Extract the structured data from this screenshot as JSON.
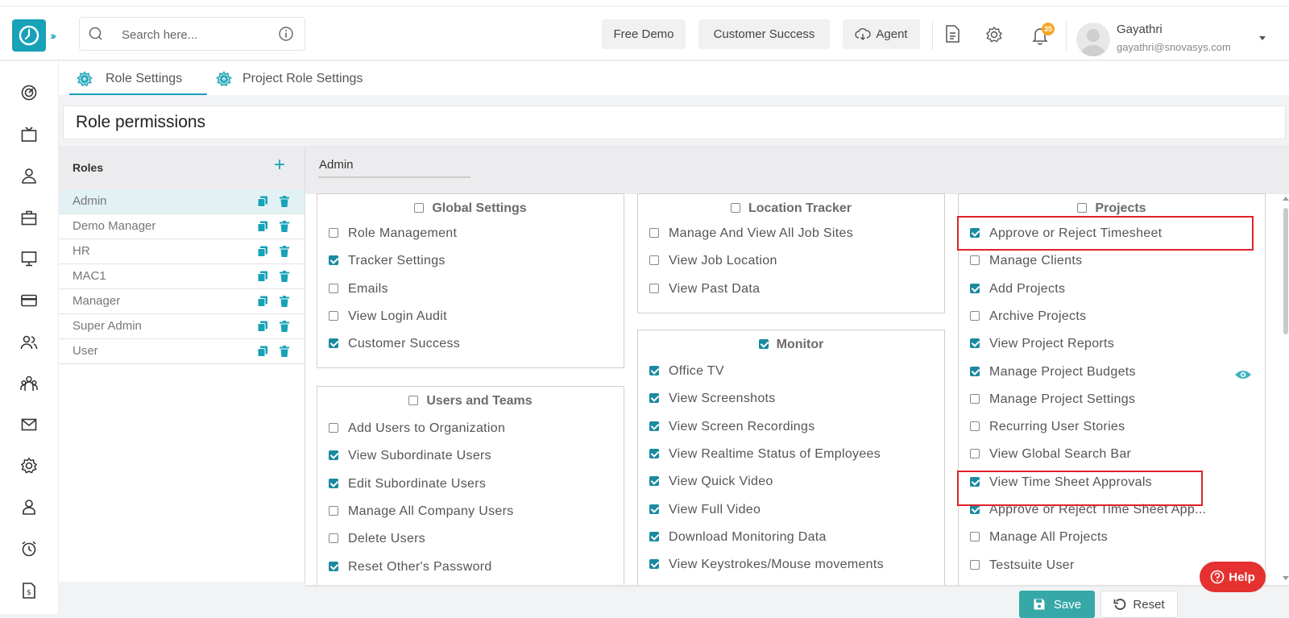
{
  "header": {
    "search_placeholder": "Search here...",
    "buttons": {
      "free_demo": "Free Demo",
      "customer_success": "Customer Success",
      "agent": "Agent"
    },
    "notification_count": "35",
    "user": {
      "name": "Gayathri",
      "email": "gayathri@snovasys.com"
    }
  },
  "tabs": [
    {
      "label": "Role Settings",
      "active": true
    },
    {
      "label": "Project Role Settings",
      "active": false
    }
  ],
  "page_title": "Role permissions",
  "roles": {
    "title": "Roles",
    "items": [
      "Admin",
      "Demo Manager",
      "HR",
      "MAC1",
      "Manager",
      "Super Admin",
      "User"
    ],
    "selected": "Admin"
  },
  "selected_role": "Admin",
  "sections": {
    "global_settings": {
      "title": "Global Settings",
      "checked": false,
      "items": [
        {
          "label": "Role Management",
          "checked": false
        },
        {
          "label": "Tracker Settings",
          "checked": true
        },
        {
          "label": "Emails",
          "checked": false
        },
        {
          "label": "View Login Audit",
          "checked": false
        },
        {
          "label": "Customer Success",
          "checked": true
        }
      ]
    },
    "users_and_teams": {
      "title": "Users and Teams",
      "checked": false,
      "items": [
        {
          "label": "Add Users to Organization",
          "checked": false
        },
        {
          "label": "View Subordinate Users",
          "checked": true
        },
        {
          "label": "Edit Subordinate Users",
          "checked": true
        },
        {
          "label": "Manage All Company Users",
          "checked": false
        },
        {
          "label": "Delete Users",
          "checked": false
        },
        {
          "label": "Reset Other's Password",
          "checked": true
        }
      ]
    },
    "location_tracker": {
      "title": "Location Tracker",
      "checked": false,
      "items": [
        {
          "label": "Manage And View All Job Sites",
          "checked": false
        },
        {
          "label": "View Job Location",
          "checked": false
        },
        {
          "label": "View Past Data",
          "checked": false
        }
      ]
    },
    "monitor": {
      "title": "Monitor",
      "checked": true,
      "items": [
        {
          "label": "Office TV",
          "checked": true
        },
        {
          "label": "View Screenshots",
          "checked": true
        },
        {
          "label": "View Screen Recordings",
          "checked": true
        },
        {
          "label": "View Realtime Status of Employees",
          "checked": true
        },
        {
          "label": "View Quick Video",
          "checked": true
        },
        {
          "label": "View Full Video",
          "checked": true
        },
        {
          "label": "Download Monitoring Data",
          "checked": true
        },
        {
          "label": "View Keystrokes/Mouse movements",
          "checked": true
        }
      ]
    },
    "projects": {
      "title": "Projects",
      "checked": false,
      "items": [
        {
          "label": "Approve or Reject Timesheet",
          "checked": true
        },
        {
          "label": "Manage Clients",
          "checked": false
        },
        {
          "label": "Add Projects",
          "checked": true
        },
        {
          "label": "Archive Projects",
          "checked": false
        },
        {
          "label": "View Project Reports",
          "checked": true
        },
        {
          "label": "Manage Project Budgets",
          "checked": true
        },
        {
          "label": "Manage Project Settings",
          "checked": false
        },
        {
          "label": "Recurring User Stories",
          "checked": false
        },
        {
          "label": "View Global Search Bar",
          "checked": false
        },
        {
          "label": "View Time Sheet Approvals",
          "checked": true
        },
        {
          "label": "Approve or Reject Time Sheet App...",
          "checked": true
        },
        {
          "label": "Manage All Projects",
          "checked": false
        },
        {
          "label": "Testsuite User",
          "checked": false
        }
      ]
    }
  },
  "footer": {
    "help": "Help",
    "save": "Save",
    "reset": "Reset"
  },
  "colors": {
    "accent": "#17a2b8",
    "checkbox": "#1a8aa0",
    "highlight": "#e0202a",
    "help": "#e5312f",
    "save": "#37a8a8"
  }
}
